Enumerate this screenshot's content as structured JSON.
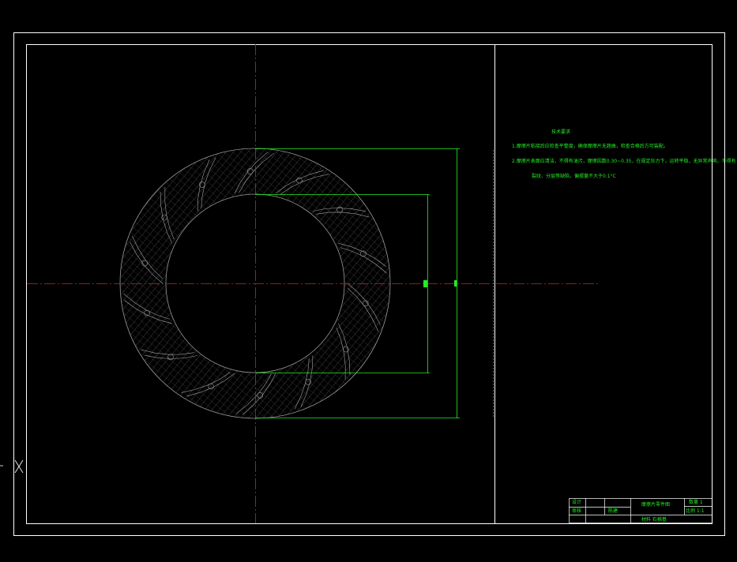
{
  "drawing": {
    "tech_requirements": {
      "heading": "技术要求",
      "line1": "1.摩擦片粘接后应检查平整度，确保摩擦片无翘曲，检查合格后方可装配。",
      "line2": "2.摩擦片表面应清洁，不得有油污，摩擦因数0.30~0.35，在规定压力下，运转平稳，无异常声响，不得有",
      "line3": "裂纹、分层等缺陷，偏摆量不大于0.1°C"
    },
    "title_block": {
      "design_label": "设计",
      "check_label": "审核",
      "check_value": "陈建",
      "drawing_name": "摩擦片零件图",
      "quantity_label": "数量 1",
      "scale_label": "比例 1:1",
      "material_label": "材料 石棉基"
    }
  },
  "colors": {
    "border": "#ffffff",
    "centerline": "#cc2222",
    "dimension": "#22ee22",
    "hatch": "#8a8a8a"
  }
}
